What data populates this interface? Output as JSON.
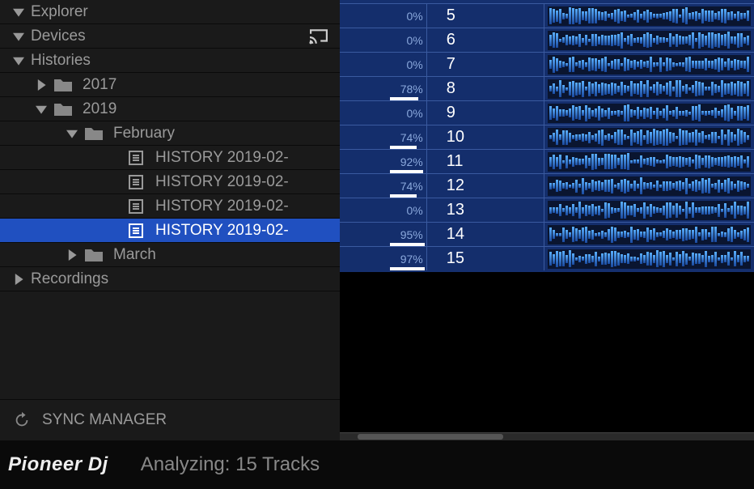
{
  "sidebar": {
    "explorer_label": "Explorer",
    "devices_label": "Devices",
    "histories_label": "Histories",
    "y2017_label": "2017",
    "y2019_label": "2019",
    "feb_label": "February",
    "mar_label": "March",
    "recordings_label": "Recordings",
    "hist_items": [
      "HISTORY 2019-02-",
      "HISTORY 2019-02-",
      "HISTORY 2019-02-",
      "HISTORY 2019-02-"
    ],
    "sync_manager_label": "SYNC MANAGER"
  },
  "tracks": [
    {
      "pct": "0%",
      "pctv": 0,
      "num": "5"
    },
    {
      "pct": "0%",
      "pctv": 0,
      "num": "6"
    },
    {
      "pct": "0%",
      "pctv": 0,
      "num": "7"
    },
    {
      "pct": "78%",
      "pctv": 78,
      "num": "8"
    },
    {
      "pct": "0%",
      "pctv": 0,
      "num": "9"
    },
    {
      "pct": "74%",
      "pctv": 74,
      "num": "10"
    },
    {
      "pct": "92%",
      "pctv": 92,
      "num": "11"
    },
    {
      "pct": "74%",
      "pctv": 74,
      "num": "12"
    },
    {
      "pct": "0%",
      "pctv": 0,
      "num": "13"
    },
    {
      "pct": "95%",
      "pctv": 95,
      "num": "14"
    },
    {
      "pct": "97%",
      "pctv": 97,
      "num": "15"
    }
  ],
  "status": {
    "logo": "Pioneer Dj",
    "analyzing": "Analyzing: 15 Tracks"
  }
}
